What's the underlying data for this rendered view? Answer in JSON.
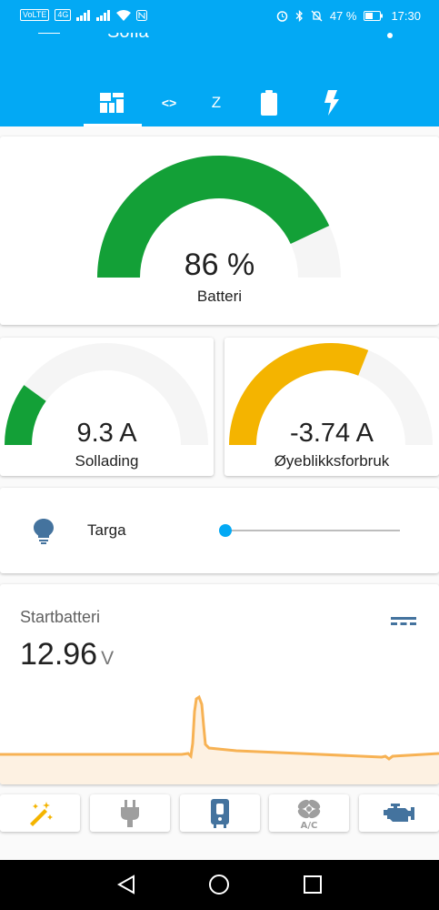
{
  "status_bar": {
    "left_chips": [
      "VoLTE",
      "4G"
    ],
    "battery": "47 %",
    "time": "17:30"
  },
  "app_bar": {
    "title": "Sofia",
    "tabs": [
      {
        "icon": "dashboard-icon"
      },
      {
        "label": "<>"
      },
      {
        "label": "Z"
      },
      {
        "icon": "battery-icon"
      },
      {
        "icon": "flash-icon"
      }
    ]
  },
  "gauges": {
    "battery": {
      "value": "86 %",
      "name": "Batteri",
      "fraction": 0.86,
      "color": "#13a037"
    },
    "solar": {
      "value": "9.3 A",
      "name": "Sollading",
      "fraction": 0.2,
      "color": "#13a037"
    },
    "consumption": {
      "value": "-3.74 A",
      "name": "Øyeblikksforbruk",
      "fraction": 0.62,
      "color": "#f4b400"
    }
  },
  "light": {
    "name": "Targa",
    "level": 0.0
  },
  "sensor": {
    "title": "Startbatteri",
    "value": "12.96",
    "unit": "V"
  },
  "quick_buttons": [
    {
      "icon": "magic-wand-icon"
    },
    {
      "icon": "power-plug-icon"
    },
    {
      "icon": "water-boiler-icon"
    },
    {
      "icon": "air-conditioner-icon"
    },
    {
      "icon": "engine-icon"
    }
  ],
  "colors": {
    "primary": "#03a9f4",
    "gauge_green": "#13a037",
    "gauge_yellow": "#f4b400",
    "icon_blue": "#44739e",
    "history_line": "#f7b254"
  }
}
